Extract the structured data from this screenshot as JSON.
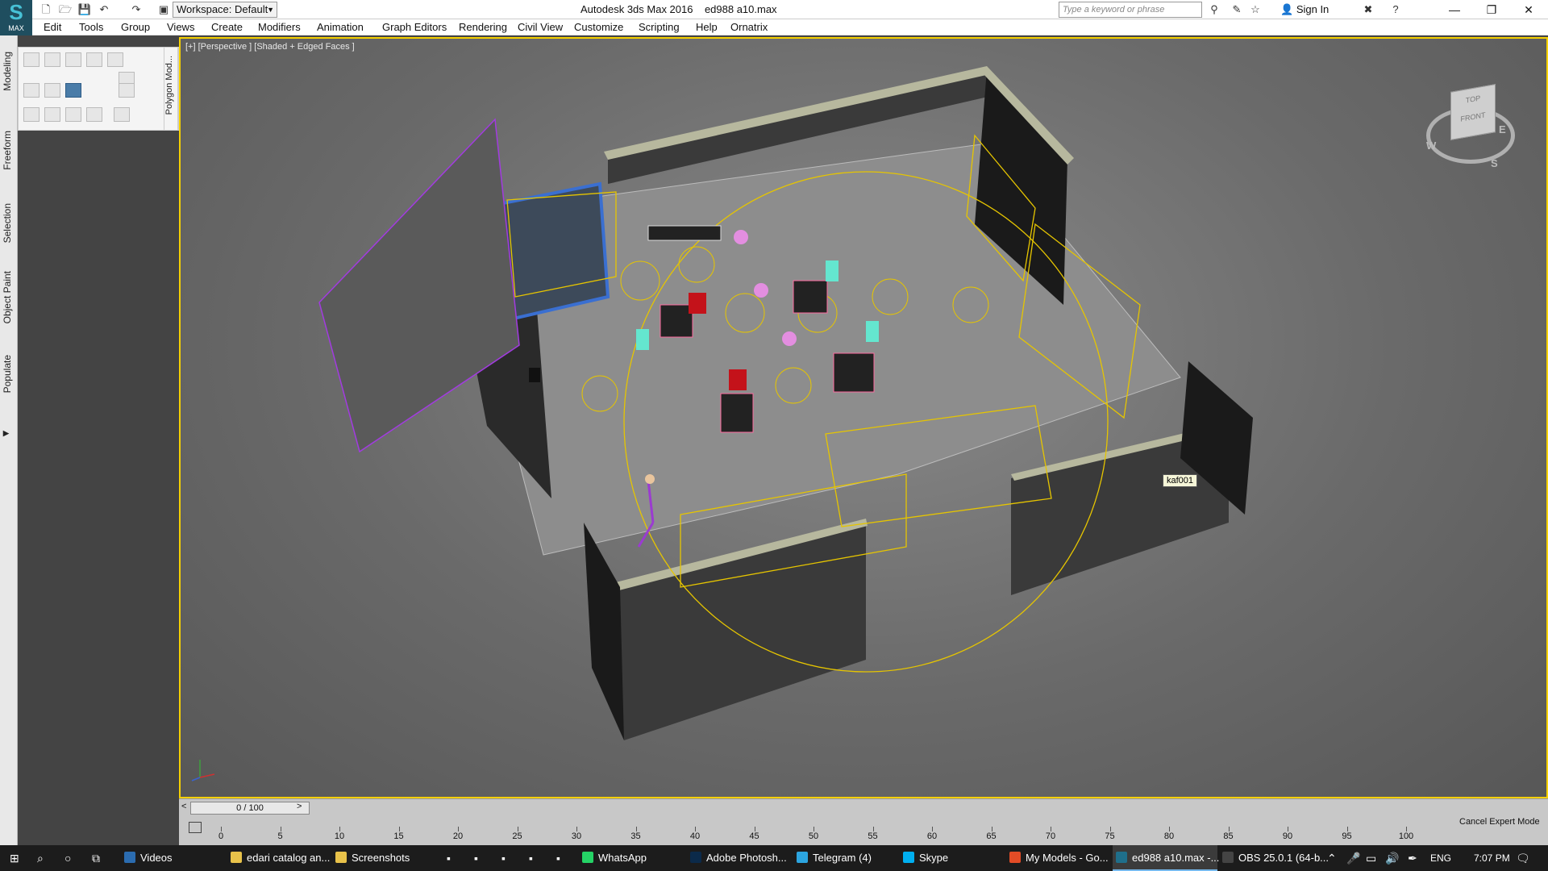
{
  "window": {
    "title": "Autodesk 3ds Max 2016",
    "filename": "ed988 a10.max",
    "app_icon_label": "MAX",
    "workspace": "Workspace: Default",
    "search_placeholder": "Type a keyword or phrase",
    "signin": "Sign In"
  },
  "menu": [
    "Edit",
    "Tools",
    "Group",
    "Views",
    "Create",
    "Modifiers",
    "Animation",
    "Graph Editors",
    "Rendering",
    "Civil View",
    "Customize",
    "Scripting",
    "Help",
    "Ornatrix"
  ],
  "ribbon_tabs": [
    "Modeling",
    "Freeform",
    "Selection",
    "Object Paint",
    "Populate"
  ],
  "ribbon_panel": "Polygon Mod...",
  "viewport": {
    "label": "[+] [Perspective ] [Shaded + Edged Faces ]",
    "tooltip": "kaf001",
    "viewcube": {
      "top": "TOP",
      "front": "FRONT",
      "compass": [
        "W",
        "S",
        "E"
      ]
    }
  },
  "timeline": {
    "frame": "0 / 100",
    "ticks": [
      "0",
      "5",
      "10",
      "15",
      "20",
      "25",
      "30",
      "35",
      "40",
      "45",
      "50",
      "55",
      "60",
      "65",
      "70",
      "75",
      "80",
      "85",
      "90",
      "95",
      "100"
    ],
    "expert": "Cancel Expert Mode"
  },
  "taskbar": {
    "items": [
      {
        "label": "Videos",
        "color": "#2b6cb0"
      },
      {
        "label": "edari catalog an...",
        "color": "#e8c24a"
      },
      {
        "label": "Screenshots",
        "color": "#e8c24a"
      },
      {
        "label": "WhatsApp",
        "color": "#25d366"
      },
      {
        "label": "Adobe Photosh...",
        "color": "#0b2a4a"
      },
      {
        "label": "Telegram (4)",
        "color": "#2ca5e0"
      },
      {
        "label": "Skype",
        "color": "#00aff0"
      },
      {
        "label": "My Models - Go...",
        "color": "#e34c26"
      },
      {
        "label": "ed988 a10.max -...",
        "color": "#1f6f8b"
      },
      {
        "label": "OBS 25.0.1 (64-b...",
        "color": "#444"
      }
    ],
    "lang": "ENG",
    "time": "7:07 PM"
  }
}
